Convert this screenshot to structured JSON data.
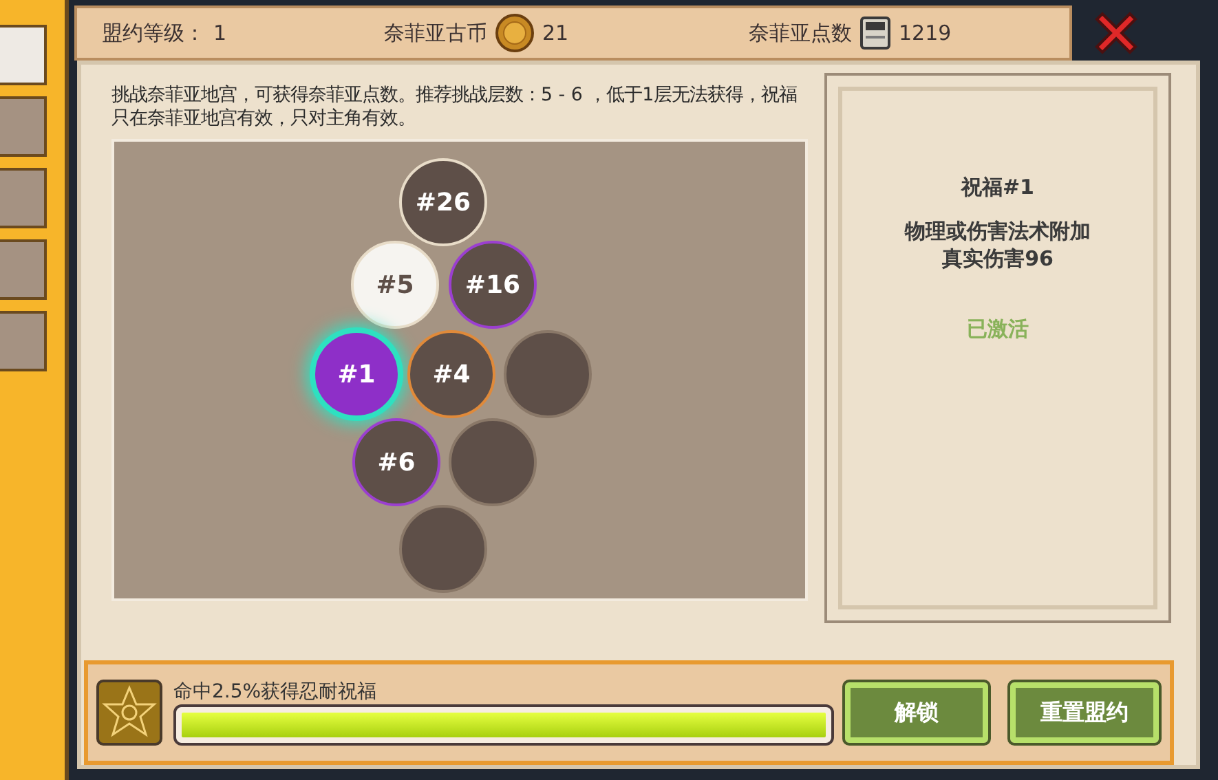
{
  "sidebar_tabs": [
    {
      "selected": true
    },
    {
      "selected": false
    },
    {
      "selected": false
    },
    {
      "selected": false
    },
    {
      "selected": false
    }
  ],
  "header": {
    "level_label": "盟约等级：",
    "level_value": "1",
    "coin_label": "奈菲亚古币",
    "coin_value": "21",
    "points_label": "奈菲亚点数",
    "points_value": "1219"
  },
  "description": "挑战奈菲亚地宫，可获得奈菲亚点数。推荐挑战层数：5 - 6 ，低于1层无法获得，祝福只在奈菲亚地宫有效，只对主角有效。",
  "nodes": [
    {
      "label": "#26",
      "kind": "dark",
      "color": "#e8dcc8",
      "selected": false
    },
    {
      "label": "#5",
      "kind": "light",
      "color": "#e8dcc8",
      "selected": false
    },
    {
      "label": "#16",
      "kind": "dark",
      "color": "#9b3fd0",
      "selected": false
    },
    {
      "label": "#1",
      "kind": "active",
      "color": "#2fe0c0",
      "selected": true
    },
    {
      "label": "#4",
      "kind": "dark",
      "color": "#e08a3a",
      "selected": false
    },
    {
      "kind": "empty",
      "color": "#8a7868",
      "selected": false
    },
    {
      "label": "#6",
      "kind": "dark",
      "color": "#9b3fd0",
      "selected": false
    },
    {
      "kind": "empty",
      "color": "#8a7868",
      "selected": false
    },
    {
      "kind": "empty",
      "color": "#8a7868",
      "selected": false
    }
  ],
  "blessing": {
    "title": "祝福#1",
    "effect": "物理或伤害法术附加真实伤害96",
    "status": "已激活"
  },
  "progress": {
    "label": "命中2.5%获得忍耐祝福",
    "level": 1
  },
  "buttons": [
    "解锁",
    "重置盟约"
  ]
}
